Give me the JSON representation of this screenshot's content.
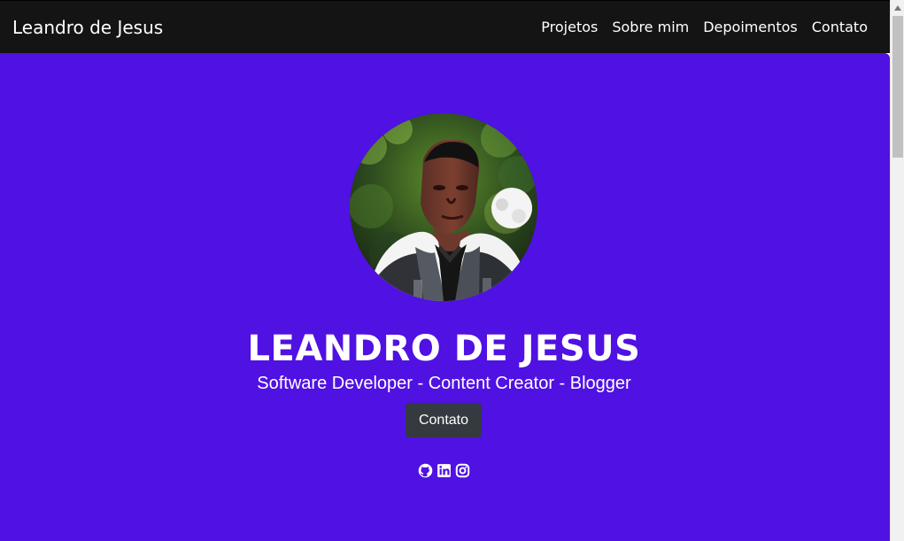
{
  "navbar": {
    "brand": "Leandro de Jesus",
    "links": [
      "Projetos",
      "Sobre mim",
      "Depoimentos",
      "Contato"
    ]
  },
  "hero": {
    "title": "LEANDRO DE JESUS",
    "subtitle": "Software Developer - Content Creator - Blogger",
    "button_label": "Contato",
    "social_icons": [
      "github-icon",
      "linkedin-icon",
      "instagram-icon"
    ]
  },
  "colors": {
    "navbar": "#141414",
    "hero_background": "#5011e3",
    "button": "#343a40",
    "text": "#ffffff"
  }
}
